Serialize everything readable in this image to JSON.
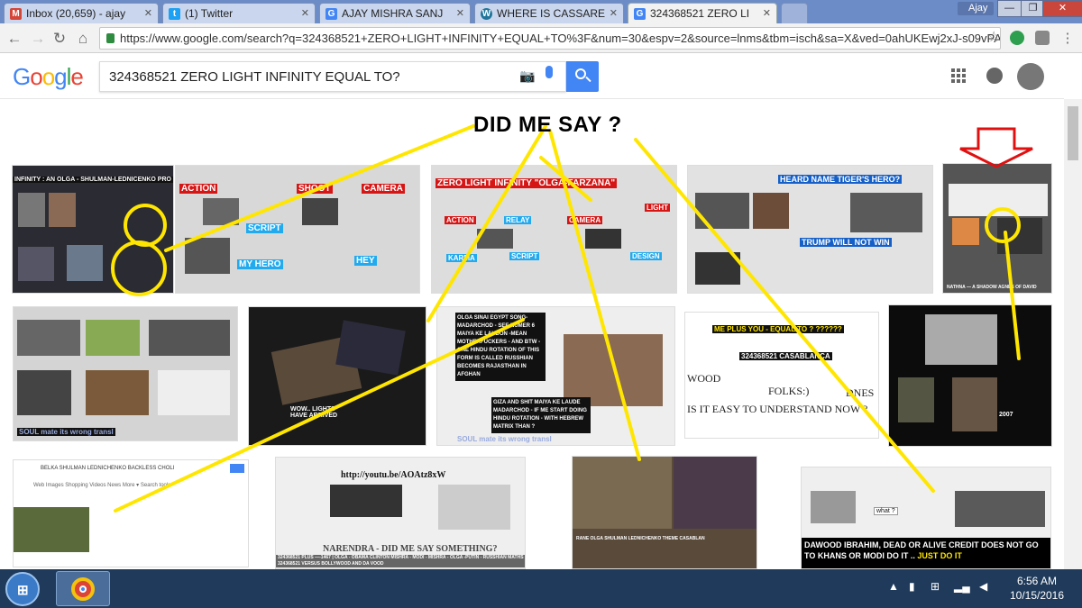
{
  "browser": {
    "tabs": [
      {
        "label": "Inbox (20,659) - ajay",
        "icon": "gmail-icon",
        "color": "#d44638"
      },
      {
        "label": "(1) Twitter",
        "icon": "twitter-icon",
        "color": "#1da1f2"
      },
      {
        "label": "AJAY MISHRA SANJ",
        "icon": "google-icon",
        "color": "#4285f4"
      },
      {
        "label": "WHERE IS CASSARE",
        "icon": "wordpress-icon",
        "color": "#21759b"
      },
      {
        "label": "324368521 ZERO LI",
        "icon": "google-icon",
        "color": "#4285f4"
      }
    ],
    "user_badge": "Ajay",
    "url": "https://www.google.com/search?q=324368521+ZERO+LIGHT+INFINITY+EQUAL+TO%3F&num=30&espv=2&source=lnms&tbm=isch&sa=X&ved=0ahUKEwj2xJ-s09vPAhUDJ5("
  },
  "google": {
    "logo": "Google",
    "query": "324368521 ZERO LIGHT INFINITY EQUAL TO?"
  },
  "overlay_headline": "DID ME SAY ?",
  "results": {
    "row1": [
      {
        "caption": "INFINITY : AN OLGA - SHULMAN-LEDNICENKO PRO"
      },
      {
        "caption_a": "ACTION",
        "caption_b": "SHOOT",
        "caption_c": "CAMERA",
        "caption_d": "SCRIPT",
        "caption_e": "MY HERO",
        "caption_f": "HEY"
      },
      {
        "caption": "ZERO LIGHT INFINITY \"OLGA-FARZANA\"",
        "caption_b": "ACTION",
        "caption_c": "RELAY",
        "caption_d": "CAMERA",
        "caption_e": "LIGHT",
        "caption_f": "KARMA",
        "caption_g": "SCRIPT",
        "caption_h": "DESIGN"
      },
      {
        "caption": "HEARD NAME TIGER'S HERO?",
        "caption_b": "TRUMP WILL NOT WIN"
      },
      {
        "caption": "NATHNA — A SHADOW AGNES OF DAVID"
      }
    ],
    "row2": [
      {
        "caption": "SOUL mate     its wrong transl"
      },
      {
        "caption": "WOW.. LIGHTS HAVE ARRIVED"
      },
      {
        "caption": "OLGA SINAI EGYPT SONG- MADARCHOD - SEE NUMER 6 MAIYA KE LAUDON -MEAN MOTHERFUCKERS - AND BTW - ONE HINDU ROTATION OF THIS FORM IS CALLED RUSSHIAN BECOMES RAJASTHAN IN AFGHAN",
        "caption_b": "GIZA AND SHIT MAIYA KE LAUDE MADARCHOD - IF ME START DOING HINDU ROTATION - WITH HEBREW MATRIX THAN ?",
        "caption_c": "SOUL mate    its wrong transl"
      },
      {
        "caption": "ME PLUS YOU - EQUAL TO ? ??????",
        "caption_b": "324368521 CASABLANCA",
        "caption_c": "WOOD",
        "caption_d": "FOLKS:)",
        "caption_e": "DNES",
        "caption_f": "IS IT EASY TO UNDERSTAND NOW ?"
      },
      {
        "caption": "2007"
      }
    ],
    "row3": [
      {
        "caption": "BELKA SHULMAN LEDNICHENKO BACKLESS CHOLI",
        "tabs": "Web   Images   Shopping   Videos   News   More ▾   Search tools"
      },
      {
        "caption": "http://youtu.be/AOAtz8xW",
        "caption_b": "NARENDRA - DID ME SAY SOMETHING?",
        "caption_c": "324368521 PLUS —-1467 | OLGA - OBAMA CLINTON MISHRA - MODI - MISHRA - OLGA -PUTIN - RUSSHIAN MATHS 324368521 VERSUS BOLLYWOOD AND DA VOOD"
      },
      {
        "caption": "RANE OLGA SHULMAN LEDNICHENKO THEME CASABLAN"
      },
      {
        "caption": "DAWOOD IBRAHIM, DEAD OR ALIVE CREDIT DOES NOT GO TO KHANS OR MODI  DO IT .. ",
        "caption_b": "JUST DO IT",
        "caption_c": "what ?"
      }
    ]
  },
  "taskbar": {
    "time": "6:56 AM",
    "date": "10/15/2016"
  },
  "colors": {
    "google_blue": "#4285f4",
    "overlay_yellow": "#ffe600",
    "red_arrow": "#e01010",
    "taskbar": "#1f3a5a"
  }
}
